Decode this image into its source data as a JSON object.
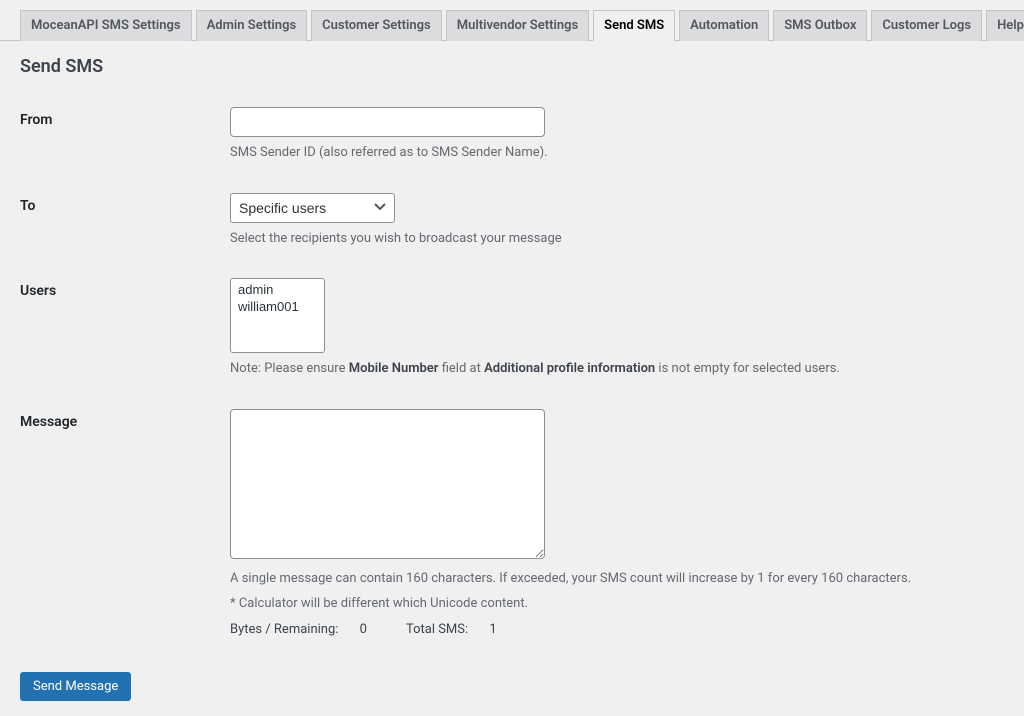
{
  "tabs": [
    {
      "label": "MoceanAPI SMS Settings",
      "active": false
    },
    {
      "label": "Admin Settings",
      "active": false
    },
    {
      "label": "Customer Settings",
      "active": false
    },
    {
      "label": "Multivendor Settings",
      "active": false
    },
    {
      "label": "Send SMS",
      "active": true
    },
    {
      "label": "Automation",
      "active": false
    },
    {
      "label": "SMS Outbox",
      "active": false
    },
    {
      "label": "Customer Logs",
      "active": false
    },
    {
      "label": "Help",
      "active": false
    }
  ],
  "page_title": "Send SMS",
  "form": {
    "from": {
      "label": "From",
      "value": "",
      "hint": "SMS Sender ID (also referred as to SMS Sender Name)."
    },
    "to": {
      "label": "To",
      "selected": "Specific users",
      "hint": "Select the recipients you wish to broadcast your message"
    },
    "users": {
      "label": "Users",
      "options": [
        "admin",
        "william001"
      ],
      "hint_prefix": "Note: Please ensure ",
      "hint_bold1": "Mobile Number",
      "hint_mid": " field at ",
      "hint_bold2": "Additional profile information",
      "hint_suffix": " is not empty for selected users."
    },
    "message": {
      "label": "Message",
      "value": "",
      "hint1": "A single message can contain 160 characters. If exceeded, your SMS count will increase by 1 for every 160 characters.",
      "hint2": "* Calculator will be different which Unicode content.",
      "bytes_label": "Bytes / Remaining: ",
      "bytes_value": "0",
      "total_label": "Total SMS: ",
      "total_value": "1"
    }
  },
  "submit_label": "Send Message"
}
